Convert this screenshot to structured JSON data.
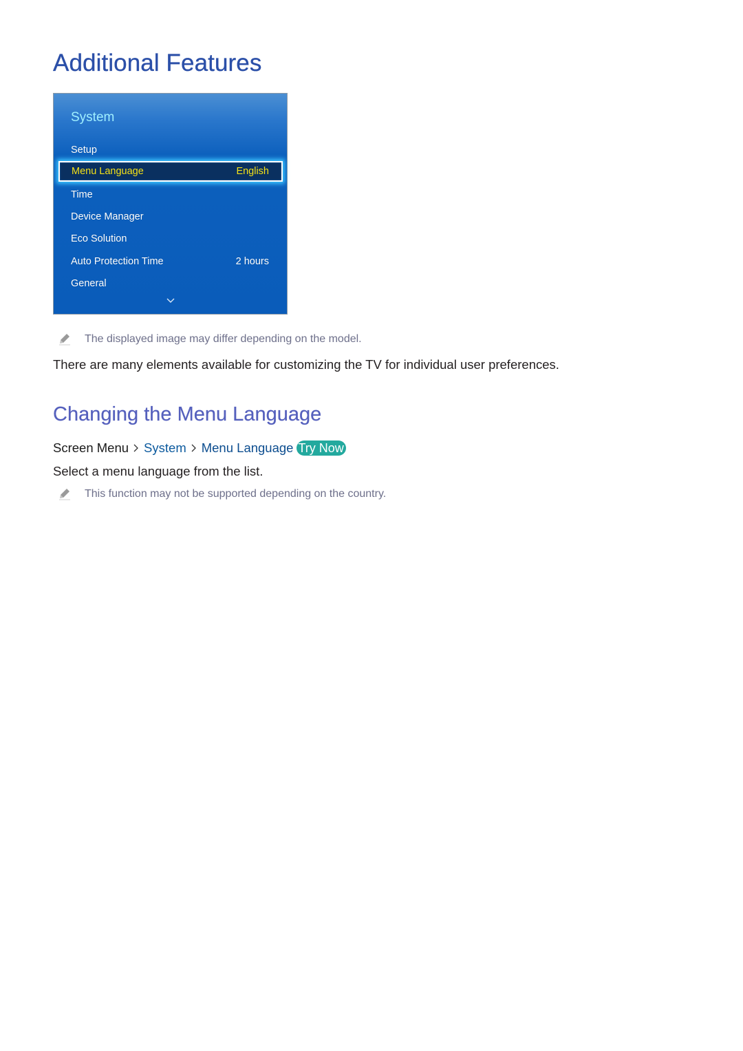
{
  "page": {
    "title": "Additional Features"
  },
  "tv_menu": {
    "title": "System",
    "items": [
      {
        "label": "Setup",
        "value": ""
      },
      {
        "label": "Menu Language",
        "value": "English",
        "selected": true
      },
      {
        "label": "Time",
        "value": ""
      },
      {
        "label": "Device Manager",
        "value": ""
      },
      {
        "label": "Eco Solution",
        "value": ""
      },
      {
        "label": "Auto Protection Time",
        "value": "2 hours"
      },
      {
        "label": "General",
        "value": ""
      }
    ],
    "more_icon": "chevron-down-icon",
    "colors": {
      "title": "#9fefff",
      "selected_text": "#f5e31b",
      "background": "#0a5cba"
    }
  },
  "notes": {
    "image_note": "The displayed image may differ depending on the model.",
    "country_note": "This function may not be supported depending on the country.",
    "icon": "pencil-icon"
  },
  "intro_text": "There are many elements available for customizing the TV for individual user preferences.",
  "section": {
    "title": "Changing the Menu Language",
    "breadcrumb": {
      "root": "Screen Menu",
      "level1": "System",
      "level2": "Menu Language",
      "try_now_label": "Try Now",
      "separator_icon": "chevron-right-icon"
    },
    "description": "Select a menu language from the list."
  },
  "colors": {
    "heading": "#2b4fa8",
    "subheading": "#5560bd",
    "link": "#0c5a9e",
    "try_now_bg": "#23a99e",
    "note_text": "#6d6f8a"
  }
}
